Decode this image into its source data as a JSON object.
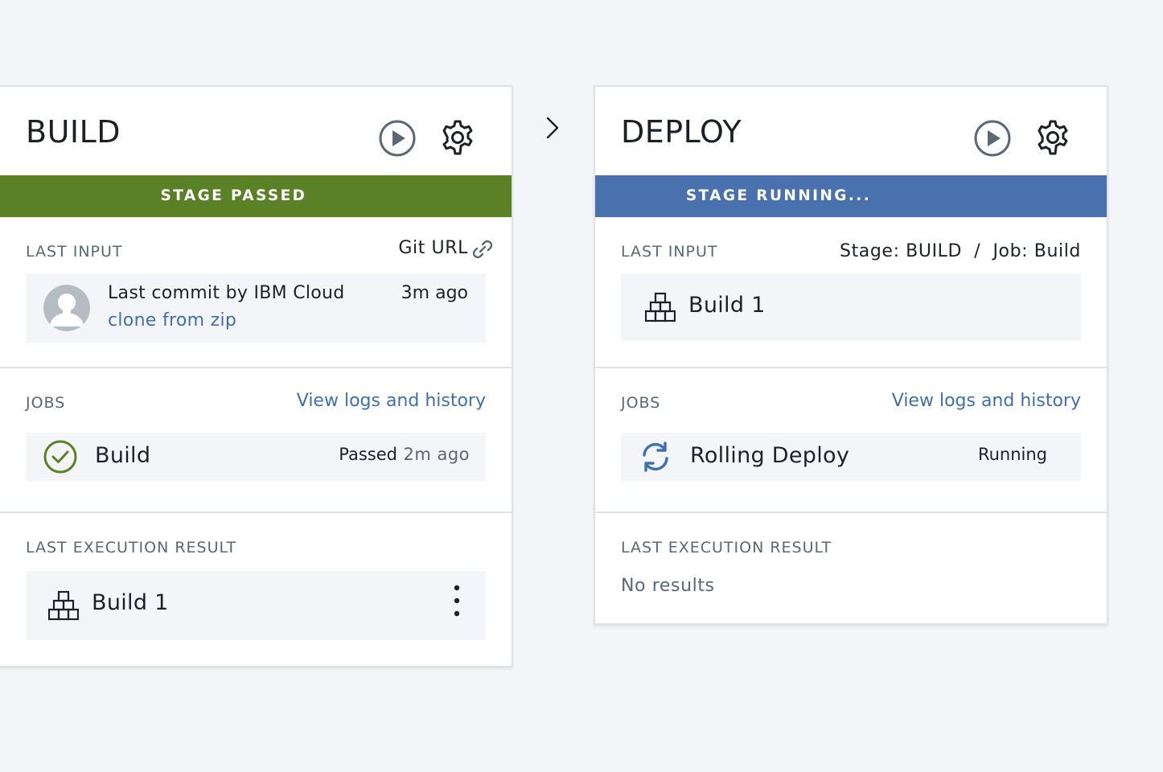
{
  "build": {
    "title": "BUILD",
    "status": "STAGE PASSED",
    "last_input": {
      "label": "LAST INPUT",
      "source": "Git URL",
      "commit_text": "Last commit by IBM Cloud",
      "commit_link": "clone from zip",
      "time": "3m ago"
    },
    "jobs": {
      "label": "JOBS",
      "link": "View logs and history",
      "items": [
        {
          "name": "Build",
          "status": "Passed",
          "time": "2m ago",
          "icon": "check-circle-icon"
        }
      ]
    },
    "last_execution": {
      "label": "LAST EXECUTION RESULT",
      "result": "Build 1"
    }
  },
  "deploy": {
    "title": "DEPLOY",
    "status": "STAGE RUNNING...",
    "last_input": {
      "label": "LAST INPUT",
      "source": "Stage: BUILD  /  Job: Build",
      "item": "Build 1"
    },
    "jobs": {
      "label": "JOBS",
      "link": "View logs and history",
      "items": [
        {
          "name": "Rolling Deploy",
          "status": "Running",
          "icon": "sync-icon"
        }
      ]
    },
    "last_execution": {
      "label": "LAST EXECUTION RESULT",
      "result": "No results"
    }
  },
  "colors": {
    "passed": "#5a8125",
    "running": "#4971ad",
    "link": "#3d70b2"
  }
}
